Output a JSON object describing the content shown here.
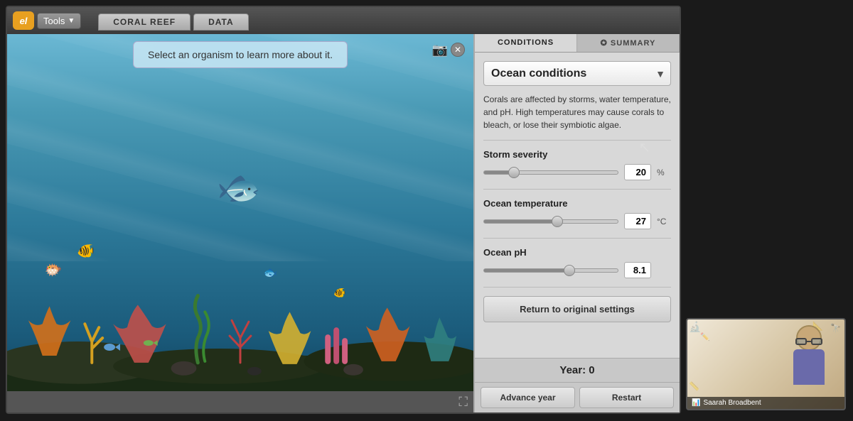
{
  "app": {
    "title": "ExploreLearning",
    "logo_text": "el"
  },
  "toolbar": {
    "tools_label": "Tools",
    "tabs": [
      {
        "label": "CORAL REEF",
        "active": false
      },
      {
        "label": "DATA",
        "active": false
      }
    ]
  },
  "sim": {
    "info_text": "Select an organism to learn more about it."
  },
  "right_panel": {
    "tabs": [
      {
        "label": "CONDITIONS",
        "active": true
      },
      {
        "label": "✪ SUMMARY",
        "active": false
      }
    ],
    "dropdown": {
      "label": "Ocean conditions",
      "value": "Ocean conditions"
    },
    "description": "Corals are affected by storms, water temperature, and pH. High temperatures may cause corals to bleach, or lose their symbiotic algae.",
    "sliders": [
      {
        "label": "Storm severity",
        "value": 20,
        "unit": "%",
        "min": 0,
        "max": 100,
        "pct": 20
      },
      {
        "label": "Ocean temperature",
        "value": 27,
        "unit": "°C",
        "min": 0,
        "max": 100,
        "pct": 55
      },
      {
        "label": "Ocean pH",
        "value": 8.1,
        "unit": "",
        "min": 0,
        "max": 100,
        "pct": 65
      }
    ],
    "return_btn": "Return to original settings",
    "year_label": "Year: 0",
    "bottom_btns": [
      {
        "label": "Advance year"
      },
      {
        "label": "Restart"
      }
    ]
  },
  "video": {
    "name": "Saarah Broadbent",
    "icon": "📊"
  },
  "icons": {
    "dropdown_arrow": "▼",
    "close": "✕",
    "camera": "📷",
    "tools_arrow": "▼"
  }
}
